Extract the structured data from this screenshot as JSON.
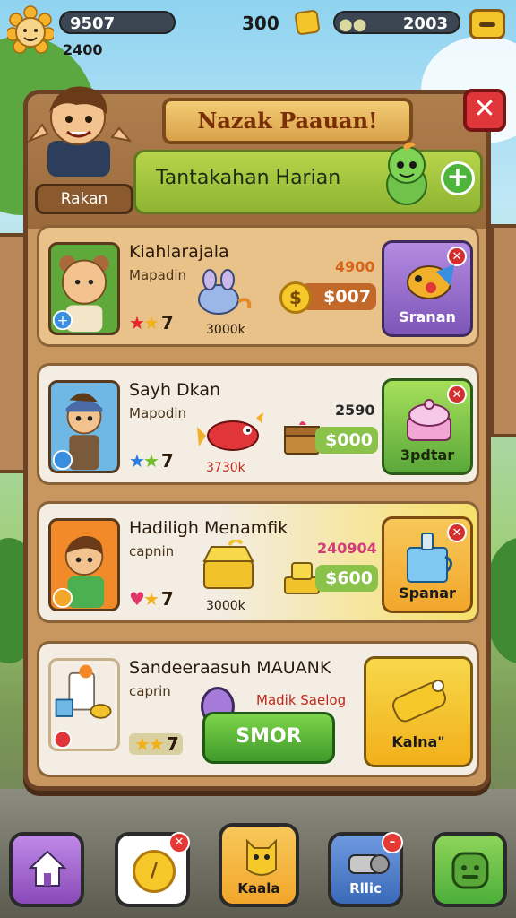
{
  "top_bar": {
    "player_coins": "9507",
    "sub_value": "2400",
    "gold_count": "300",
    "gems_count": "2003"
  },
  "panel": {
    "title": "Nazak Paauan!",
    "player_name": "Rakan",
    "subtitle": "Tantakahan Harian"
  },
  "offers": [
    {
      "title": "Kiahlarajala",
      "subtitle": "Mapadin",
      "stars": "7",
      "item_label": "3000k",
      "old_price": "4900",
      "price": "$007",
      "shop_label": "Sranan"
    },
    {
      "title": "Sayh Dkan",
      "subtitle": "Mapodin",
      "stars": "7",
      "item_label": "3730k",
      "old_price": "2590",
      "price": "$000",
      "shop_label": "3pdtar"
    },
    {
      "title": "Hadiligh Menamfik",
      "subtitle": "capnin",
      "stars": "7",
      "item_label": "3000k",
      "old_price": "240904",
      "price": "$600",
      "shop_label": "Spanar"
    },
    {
      "title": "Sandeeraasuh MAUANK",
      "subtitle": "caprin",
      "stars": "7",
      "deal_label": "Madik Saelog",
      "button_label": "SMOR",
      "shop_label": "Kalna\""
    }
  ],
  "bottom_nav": [
    {
      "label": ""
    },
    {
      "label": ""
    },
    {
      "label": "Kaala"
    },
    {
      "label": "Rllic"
    },
    {
      "label": ""
    }
  ],
  "colors": {
    "wood": "#c89760",
    "accent_green": "#8fb533",
    "close_red": "#e0363a",
    "gold": "#f7c82a"
  }
}
